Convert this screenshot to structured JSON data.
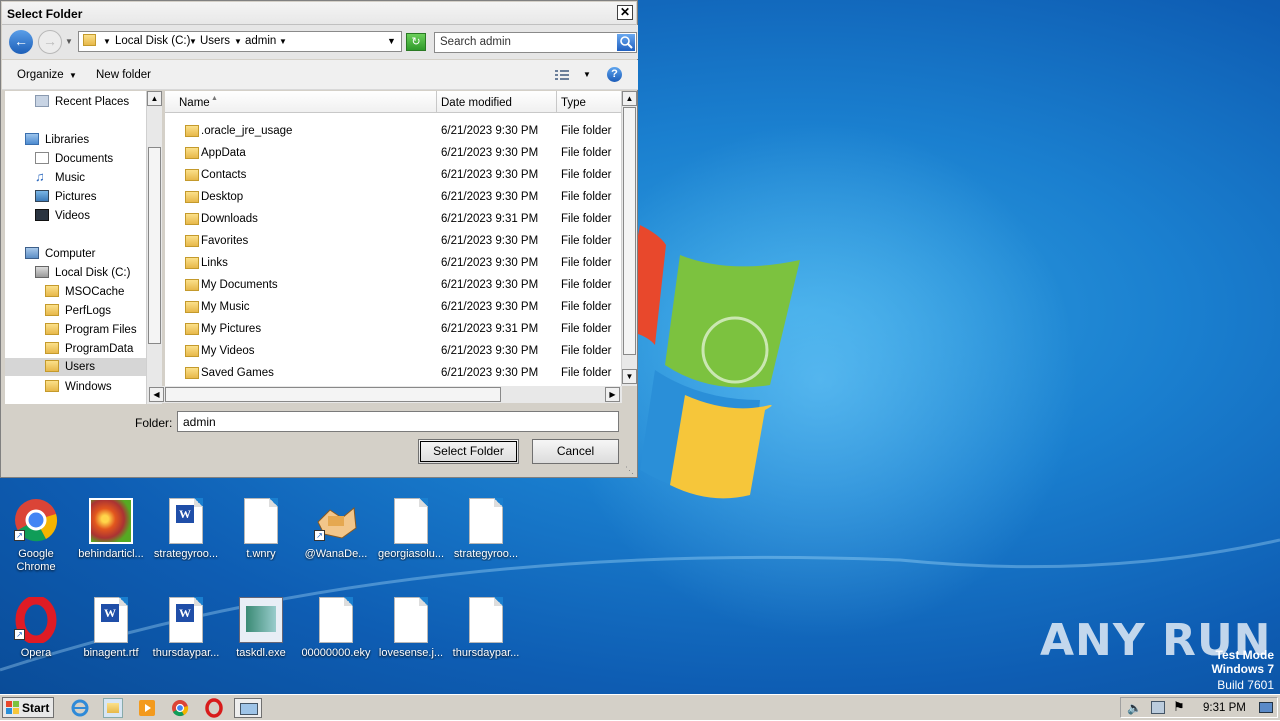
{
  "dialog": {
    "title": "Select Folder",
    "close_label": "✕",
    "address": {
      "crumbs": [
        "Local Disk (C:)",
        "Users",
        "admin"
      ],
      "separator": "▸"
    },
    "search_placeholder": "Search admin",
    "toolbar": {
      "organize": "Organize",
      "new_folder": "New folder",
      "help": "?"
    },
    "tree": [
      {
        "label": "Recent Places",
        "icon": "recent-places-icon"
      },
      {
        "label": "Libraries",
        "icon": "libraries-icon"
      },
      {
        "label": "Documents",
        "icon": "documents-icon"
      },
      {
        "label": "Music",
        "icon": "music-icon"
      },
      {
        "label": "Pictures",
        "icon": "pictures-icon"
      },
      {
        "label": "Videos",
        "icon": "videos-icon"
      },
      {
        "label": "Computer",
        "icon": "computer-icon"
      },
      {
        "label": "Local Disk (C:)",
        "icon": "drive-icon"
      },
      {
        "label": "MSOCache",
        "icon": "folder-locked-icon"
      },
      {
        "label": "PerfLogs",
        "icon": "folder-icon"
      },
      {
        "label": "Program Files",
        "icon": "folder-icon"
      },
      {
        "label": "ProgramData",
        "icon": "folder-icon"
      },
      {
        "label": "Users",
        "icon": "folder-icon"
      },
      {
        "label": "Windows",
        "icon": "folder-icon"
      }
    ],
    "columns": {
      "name": "Name",
      "date": "Date modified",
      "type": "Type"
    },
    "files": [
      {
        "name": ".oracle_jre_usage",
        "date": "6/21/2023 9:30 PM",
        "type": "File folder"
      },
      {
        "name": "AppData",
        "date": "6/21/2023 9:30 PM",
        "type": "File folder"
      },
      {
        "name": "Contacts",
        "date": "6/21/2023 9:30 PM",
        "type": "File folder"
      },
      {
        "name": "Desktop",
        "date": "6/21/2023 9:30 PM",
        "type": "File folder"
      },
      {
        "name": "Downloads",
        "date": "6/21/2023 9:31 PM",
        "type": "File folder"
      },
      {
        "name": "Favorites",
        "date": "6/21/2023 9:30 PM",
        "type": "File folder"
      },
      {
        "name": "Links",
        "date": "6/21/2023 9:30 PM",
        "type": "File folder"
      },
      {
        "name": "My Documents",
        "date": "6/21/2023 9:30 PM",
        "type": "File folder"
      },
      {
        "name": "My Music",
        "date": "6/21/2023 9:30 PM",
        "type": "File folder"
      },
      {
        "name": "My Pictures",
        "date": "6/21/2023 9:31 PM",
        "type": "File folder"
      },
      {
        "name": "My Videos",
        "date": "6/21/2023 9:30 PM",
        "type": "File folder"
      },
      {
        "name": "Saved Games",
        "date": "6/21/2023 9:30 PM",
        "type": "File folder"
      }
    ],
    "folder_label": "Folder:",
    "folder_value": "admin",
    "select_button": "Select Folder",
    "cancel_button": "Cancel"
  },
  "desktop_icons": {
    "row1": [
      {
        "label": "Google Chrome",
        "kind": "chrome-icon"
      },
      {
        "label": "behindarticl...",
        "kind": "image-file-icon"
      },
      {
        "label": "strategyroo...",
        "kind": "word-doc-icon"
      },
      {
        "label": "t.wnry",
        "kind": "blank-file-icon"
      },
      {
        "label": "@WanaDe...",
        "kind": "wanadecryptor-icon"
      },
      {
        "label": "georgiasolu...",
        "kind": "blank-file-icon"
      },
      {
        "label": "strategyroo...",
        "kind": "blank-file-icon"
      }
    ],
    "row2": [
      {
        "label": "Opera",
        "kind": "opera-icon"
      },
      {
        "label": "binagent.rtf",
        "kind": "word-doc-icon"
      },
      {
        "label": "thursdaypar...",
        "kind": "word-doc-icon"
      },
      {
        "label": "taskdl.exe",
        "kind": "exe-icon"
      },
      {
        "label": "00000000.eky",
        "kind": "blank-file-icon"
      },
      {
        "label": "lovesense.j...",
        "kind": "blank-file-icon"
      },
      {
        "label": "thursdaypar...",
        "kind": "blank-file-icon"
      }
    ]
  },
  "watermark": {
    "brand": "ANY RUN",
    "line1": "Test Mode",
    "line2": "Windows 7",
    "line3": "Build 7601"
  },
  "taskbar": {
    "start_label": "Start",
    "clock": "9:31 PM",
    "pinned": [
      "ie-icon",
      "explorer-icon",
      "media-player-icon",
      "chrome-icon",
      "opera-icon",
      "dialog-window-icon"
    ]
  },
  "colors": {
    "desktop": "#1a7fcf",
    "dialog_bg": "#d4d0c8",
    "selection": "#d6d6d6"
  }
}
